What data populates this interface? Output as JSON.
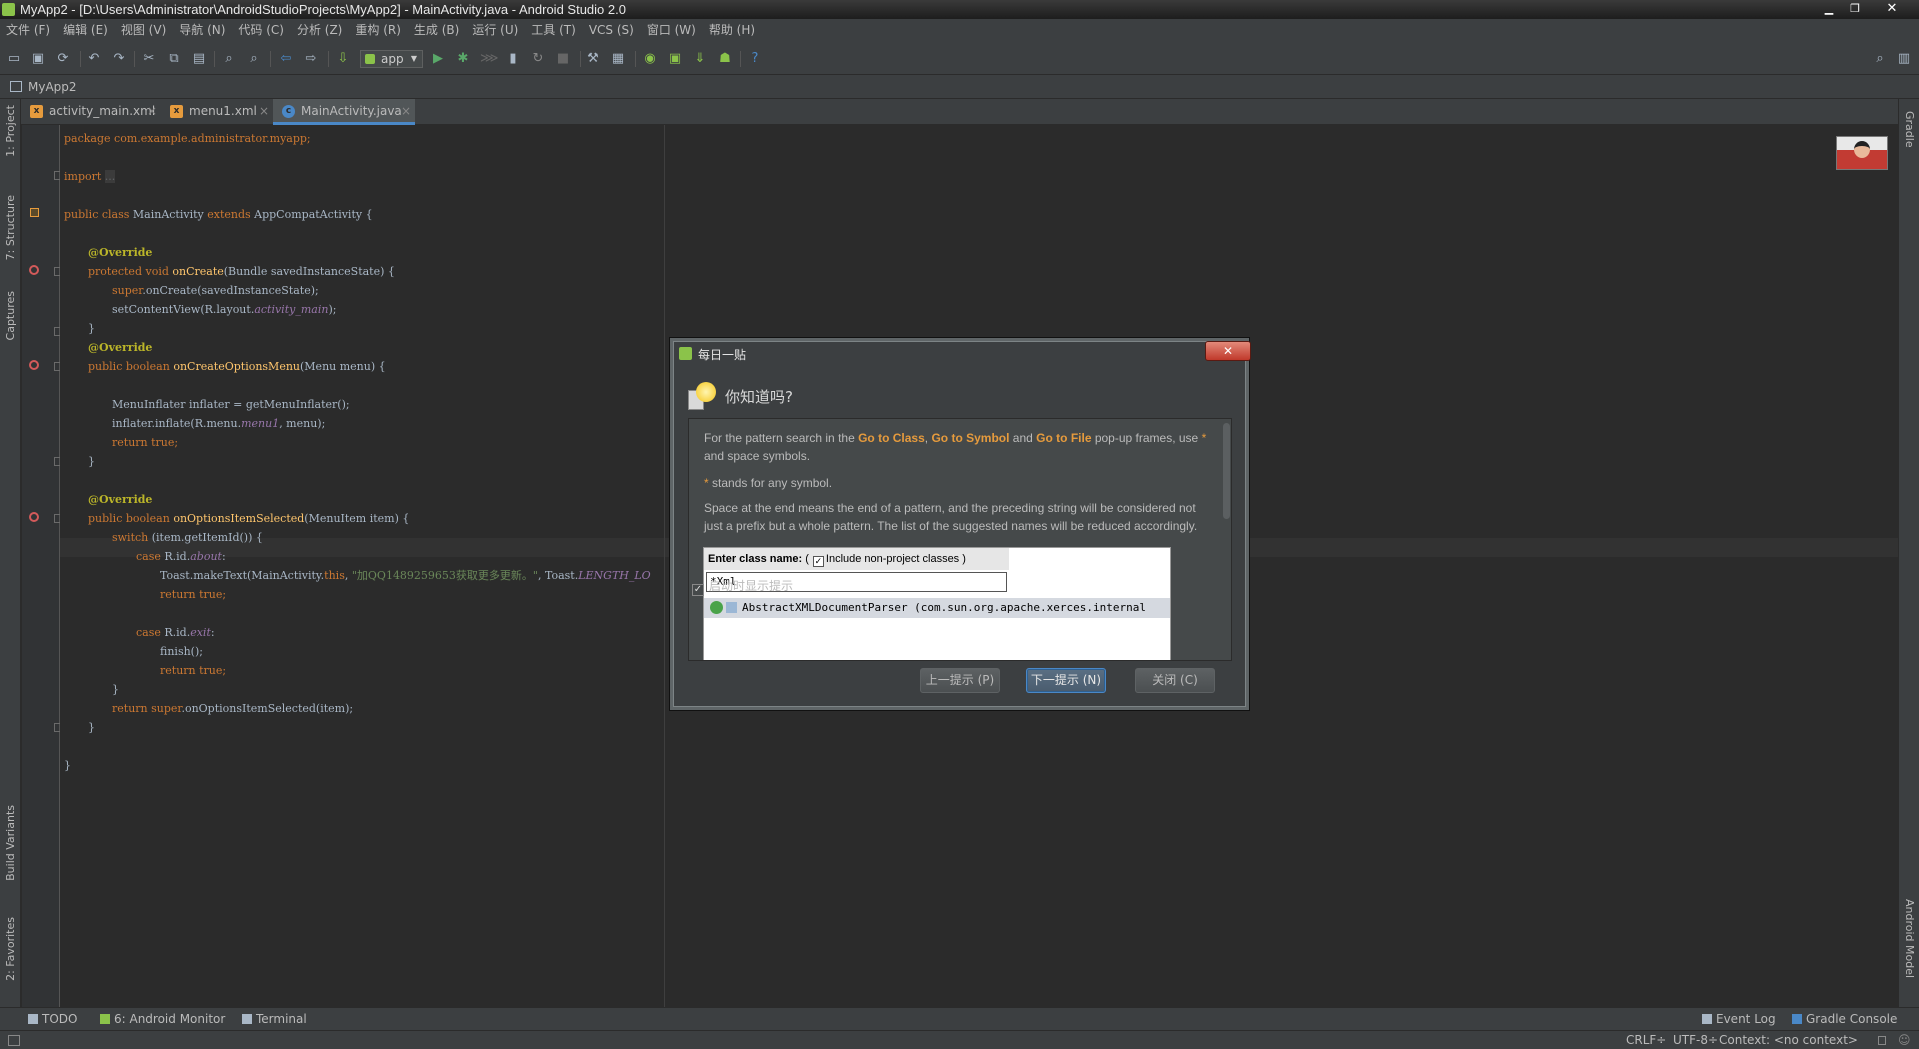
{
  "window": {
    "title": "MyApp2 - [D:\\Users\\Administrator\\AndroidStudioProjects\\MyApp2] - MainActivity.java - Android Studio 2.0",
    "min": "▁",
    "max": "❐",
    "close": "✕"
  },
  "menu": [
    "文件 (F)",
    "编辑 (E)",
    "视图 (V)",
    "导航 (N)",
    "代码 (C)",
    "分析 (Z)",
    "重构 (R)",
    "生成 (B)",
    "运行 (U)",
    "工具 (T)",
    "VCS (S)",
    "窗口 (W)",
    "帮助 (H)"
  ],
  "toolbar": {
    "run_config": "app",
    "icons": [
      "open-icon",
      "save-icon",
      "sync-icon",
      "undo-icon",
      "redo-icon",
      "cut-icon",
      "copy-icon",
      "paste-icon",
      "find-icon",
      "replace-icon",
      "back-icon",
      "forward-icon",
      "make-icon",
      "run-icon",
      "debug-icon",
      "attach-icon",
      "coverage-icon",
      "apply-icon",
      "stop-icon",
      "project-structure-icon",
      "sdk-icon",
      "avd-icon",
      "device-monitor-icon",
      "android-icon",
      "help-icon"
    ]
  },
  "navbar": {
    "project": "MyApp2"
  },
  "tabs": [
    {
      "label": "activity_main.xml",
      "type": "xml",
      "icon_color": "#e69b3d"
    },
    {
      "label": "menu1.xml",
      "type": "xml",
      "icon_color": "#e69b3d"
    },
    {
      "label": "MainActivity.java",
      "type": "class",
      "icon_color": "#4a88c7",
      "active": true
    }
  ],
  "left_tools": {
    "project": "1: Project",
    "structure": "7: Structure",
    "captures": "Captures",
    "build_variants": "Build Variants",
    "favorites": "2: Favorites"
  },
  "right_tools": {
    "gradle": "Gradle",
    "android_model": "Android Model"
  },
  "code": {
    "l1": "package com.example.administrator.myapp;",
    "l3_kw": "import",
    "l3_dots": "...",
    "l5": [
      "public class ",
      "MainActivity ",
      "extends ",
      "AppCompatActivity {"
    ],
    "override": "@Override",
    "oncreate_sig": [
      "protected void ",
      "onCreate",
      "(Bundle savedInstanceState) {"
    ],
    "super_oncreate": [
      "super",
      ".onCreate(savedInstanceState);"
    ],
    "setcontent": [
      "setContentView(R.layout.",
      "activity_main",
      ");"
    ],
    "close_brace": "}",
    "menu_sig": [
      "public boolean ",
      "onCreateOptionsMenu",
      "(Menu menu) {"
    ],
    "inflater": "MenuInflater inflater = getMenuInflater();",
    "inflate": [
      "inflater.inflate(R.menu.",
      "menu1",
      ", menu);"
    ],
    "return_true": [
      "return true",
      ";"
    ],
    "item_sig": [
      "public boolean ",
      "onOptionsItemSelected",
      "(MenuItem item) {"
    ],
    "switch": [
      "switch ",
      "(item.getItemId()) {"
    ],
    "case_about": [
      "case ",
      "R.id.",
      "about",
      ":"
    ],
    "toast": [
      "Toast.makeText(MainActivity.",
      "this",
      ", ",
      "\"加QQ1489259653获取更多更新。\"",
      ", Toast.",
      "LENGTH_LO"
    ],
    "case_exit": [
      "case ",
      "R.id.",
      "exit",
      ":"
    ],
    "finish": "finish();",
    "return_super": [
      "return super",
      ".onOptionsItemSelected(item);"
    ]
  },
  "bottom_tools": {
    "todo": "TODO",
    "monitor": "6: Android Monitor",
    "terminal": "Terminal",
    "event_log": "Event Log",
    "gradle_console": "Gradle Console"
  },
  "status": {
    "crlf": "CRLF÷",
    "encoding": "UTF-8÷",
    "context": "Context: <no context>"
  },
  "dialog": {
    "title": "每日一贴",
    "heading": "你知道吗?",
    "p1_a": "For the pattern search in the ",
    "p1_goto_class": "Go to Class",
    "p1_comma": ", ",
    "p1_goto_symbol": "Go to Symbol",
    "p1_and": " and ",
    "p1_goto_file": "Go to File",
    "p1_b": " pop-up frames, use ",
    "p1_star": "*",
    "p1_c": "and space symbols.",
    "p2_star": "*",
    "p2": " stands for any symbol.",
    "p3": "Space at the end means the end of a pattern, and the preceding string will be considered not just a prefix but a whole pattern. The list of the suggested names will be reduced accordingly.",
    "shot_label": "Enter class name:",
    "shot_paren_open": "(",
    "shot_check": "✓",
    "shot_include": "Include non-project classes",
    "shot_paren_close": ")",
    "shot_input": "*Xml",
    "shot_result": "AbstractXMLDocumentParser (com.sun.org.apache.xerces.internal",
    "show_on_startup": "启动时显示提示",
    "show_on_startup_checked": true,
    "prev": "上一提示 (P)",
    "next": "下一提示 (N)",
    "close": "关闭 (C)",
    "close_x": "✕"
  }
}
